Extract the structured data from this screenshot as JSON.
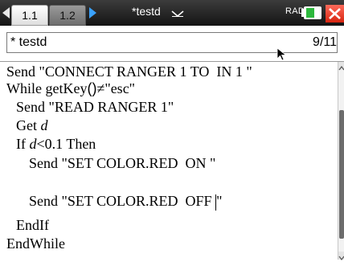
{
  "tabs": [
    {
      "label": "1.1",
      "active": true
    },
    {
      "label": "1.2",
      "active": false
    }
  ],
  "document": {
    "title": "*testd"
  },
  "status": {
    "angle_mode": "RAD"
  },
  "editor": {
    "program_name": "* testd",
    "line_position": "9/11",
    "lines": {
      "l1": "Send \"CONNECT RANGER 1 TO  IN 1 \"",
      "l2a": "While getKey",
      "l2b": "()",
      "l2c": "≠\"esc\"",
      "l3": "Send \"READ RANGER 1\"",
      "l4a": "Get ",
      "l4b": "d",
      "l5a": "If ",
      "l5b": "d",
      "l5c": "<0.1 Then",
      "l6": "Send \"SET COLOR.RED  ON \"",
      "l8": "Send \"SET COLOR.RED  OFF ",
      "l8b": "\"",
      "l9": "EndIf",
      "l10": "EndWhile"
    }
  },
  "colors": {
    "topbar": "#1e1e1e",
    "next_arrow": "#3aa2ff",
    "battery": "#2db83d",
    "close": "#e23b26"
  }
}
